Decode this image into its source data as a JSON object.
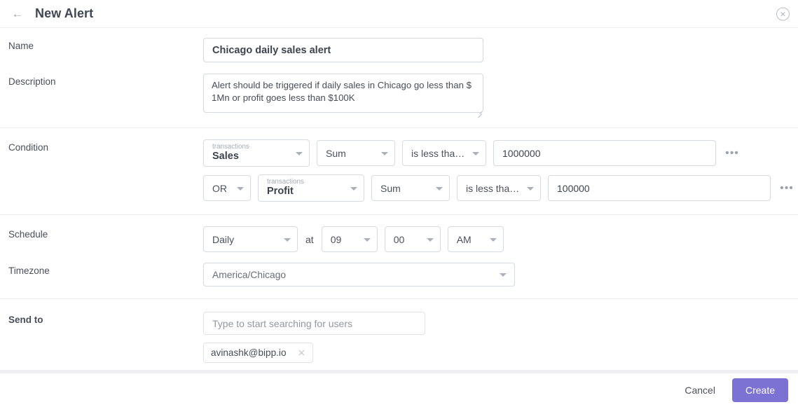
{
  "header": {
    "title": "New Alert",
    "back_icon": "arrow-left-icon",
    "close_icon": "close-circle-icon",
    "back_glyph": "←",
    "close_glyph": "×"
  },
  "form": {
    "name": {
      "label": "Name",
      "value": "Chicago daily sales alert",
      "placeholder": ""
    },
    "description": {
      "label": "Description",
      "value": "Alert should be triggered if daily sales in Chicago go less than $ 1Mn or profit goes less than $100K",
      "placeholder": ""
    },
    "condition": {
      "label": "Condition",
      "more_glyph": "•••",
      "rows": [
        {
          "logic": null,
          "field_source": "transactions",
          "field_name": "Sales",
          "aggregate": "Sum",
          "operator": "is less tha…",
          "value": "1000000",
          "more_label": "•••"
        },
        {
          "logic": "OR",
          "field_source": "transactions",
          "field_name": "Profit",
          "aggregate": "Sum",
          "operator": "is less tha…",
          "value": "100000",
          "more_label": "•••"
        }
      ]
    },
    "schedule": {
      "label": "Schedule",
      "frequency": "Daily",
      "at_label": "at",
      "hour": "09",
      "minute": "00",
      "meridiem": "AM"
    },
    "timezone": {
      "label": "Timezone",
      "value": "America/Chicago"
    },
    "send_to": {
      "label": "Send to",
      "search_value": "",
      "search_placeholder": "Type to start searching for users",
      "recipients": [
        {
          "email": "avinashk@bipp.io",
          "remove_glyph": "×"
        }
      ]
    }
  },
  "footer": {
    "cancel_label": "Cancel",
    "create_label": "Create"
  },
  "colors": {
    "accent": "#7b72d4",
    "border": "#d7dbe2",
    "text": "#3d4450",
    "muted": "#9198a3",
    "divider": "#eceef1"
  }
}
